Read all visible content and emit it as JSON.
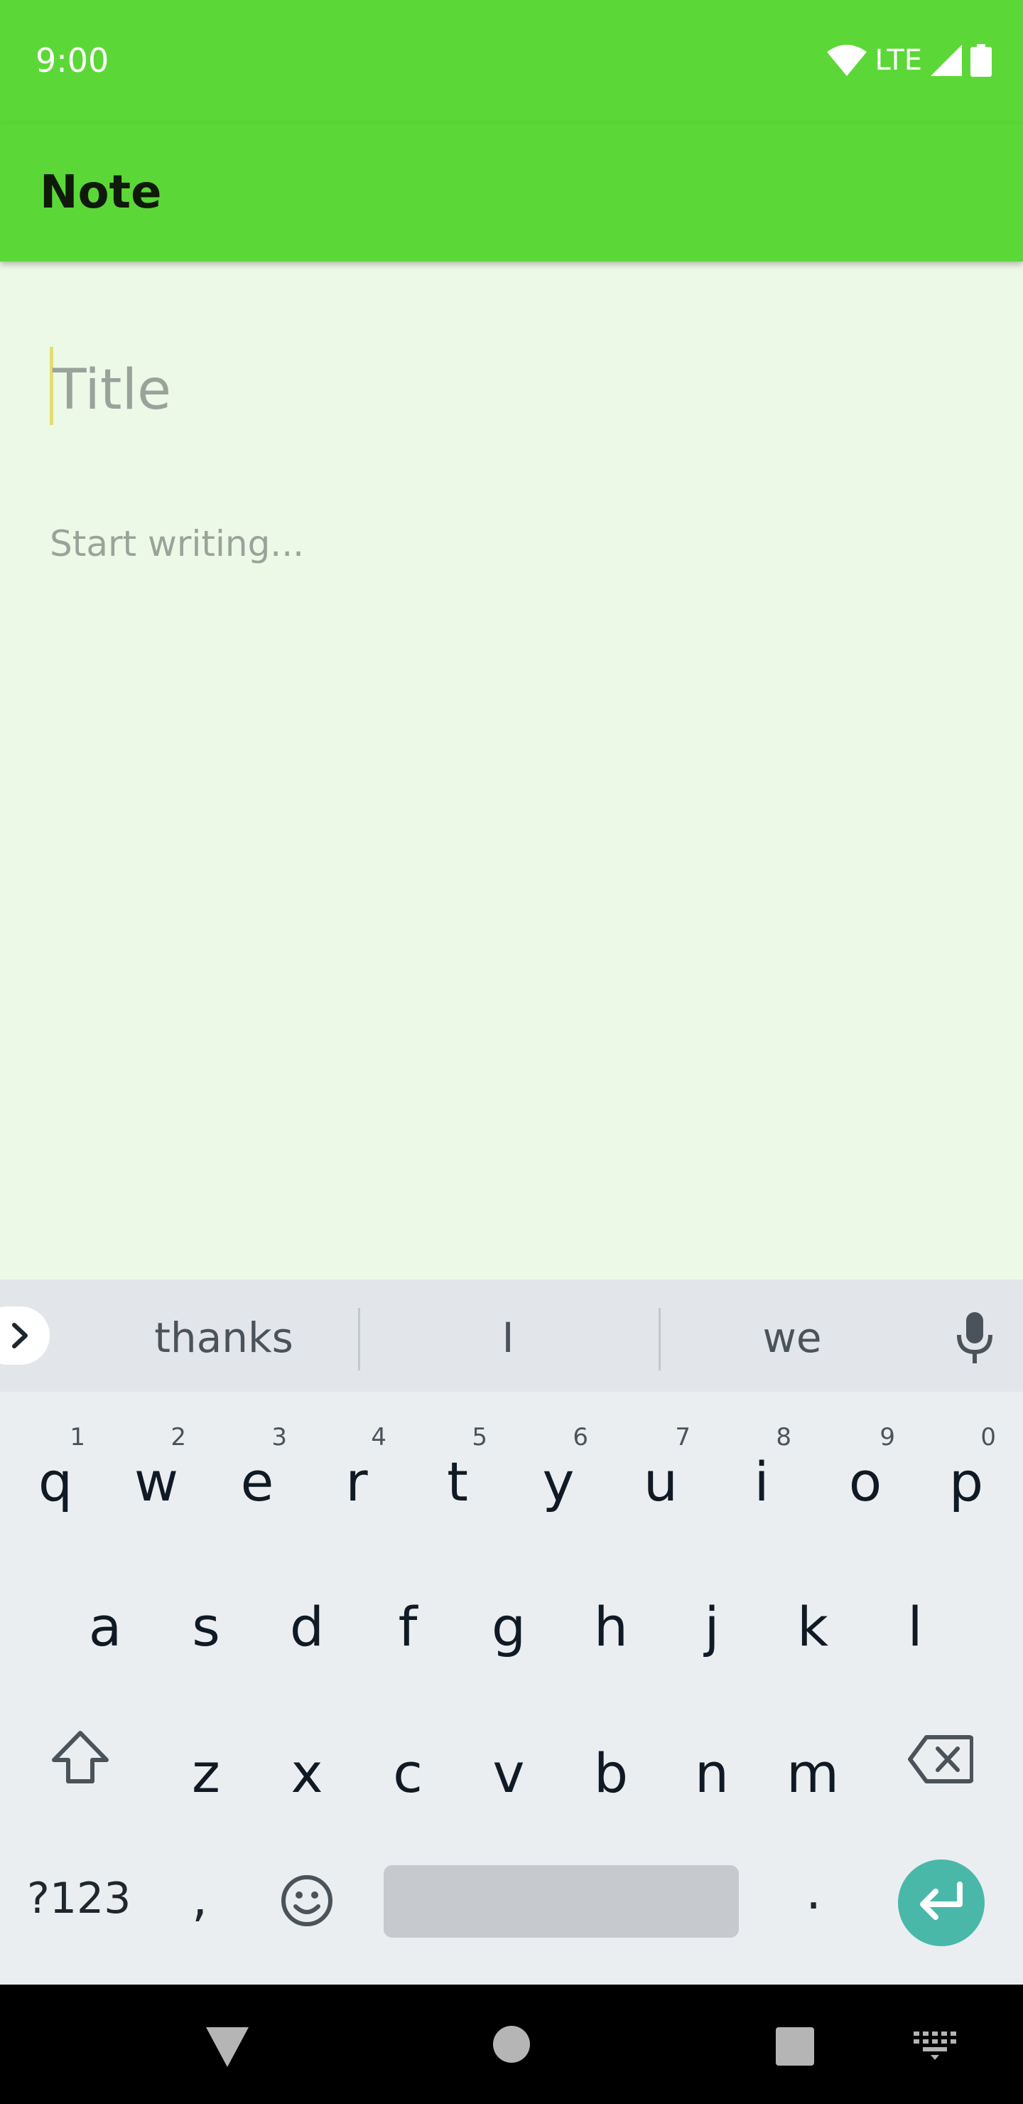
{
  "status_bar": {
    "time": "9:00",
    "network": "LTE"
  },
  "app_bar": {
    "title": "Note"
  },
  "editor": {
    "title_placeholder": "Title",
    "body_placeholder": "Start writing..."
  },
  "keyboard": {
    "suggestions": [
      "thanks",
      "I",
      "we"
    ],
    "row1": [
      {
        "ch": "q",
        "hint": "1"
      },
      {
        "ch": "w",
        "hint": "2"
      },
      {
        "ch": "e",
        "hint": "3"
      },
      {
        "ch": "r",
        "hint": "4"
      },
      {
        "ch": "t",
        "hint": "5"
      },
      {
        "ch": "y",
        "hint": "6"
      },
      {
        "ch": "u",
        "hint": "7"
      },
      {
        "ch": "i",
        "hint": "8"
      },
      {
        "ch": "o",
        "hint": "9"
      },
      {
        "ch": "p",
        "hint": "0"
      }
    ],
    "row2": [
      "a",
      "s",
      "d",
      "f",
      "g",
      "h",
      "j",
      "k",
      "l"
    ],
    "row3": [
      "z",
      "x",
      "c",
      "v",
      "b",
      "n",
      "m"
    ],
    "symbols_label": "?123",
    "comma_label": ",",
    "period_label": "."
  },
  "icons": {
    "status": [
      "wifi-icon",
      "signal-icon",
      "battery-icon"
    ],
    "keyboard": [
      "expand-suggestions-icon",
      "microphone-icon",
      "shift-icon",
      "backspace-icon",
      "emoji-icon",
      "enter-icon"
    ],
    "nav": [
      "back-icon",
      "home-icon",
      "recents-icon",
      "keyboard-switch-icon"
    ]
  },
  "colors": {
    "accent": "#5bd837",
    "background": "#edf9e7",
    "enter_key": "#49b8a9"
  }
}
